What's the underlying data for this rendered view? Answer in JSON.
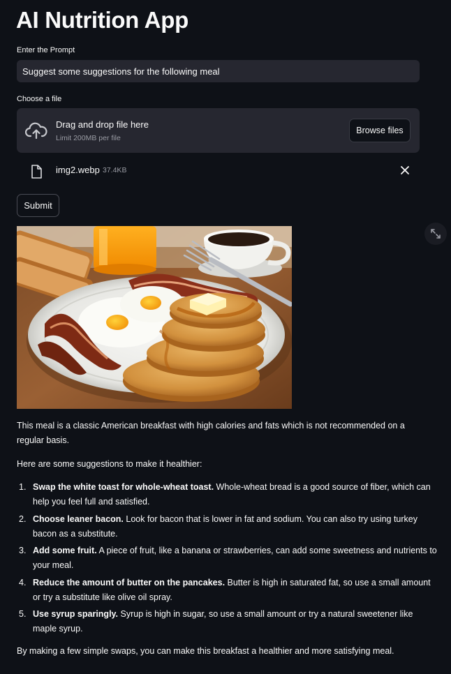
{
  "app": {
    "title": "AI Nutrition App"
  },
  "prompt": {
    "label": "Enter the Prompt",
    "value": "Suggest some suggestions for the following meal"
  },
  "uploader": {
    "label": "Choose a file",
    "drop_text": "Drag and drop file here",
    "limit_text": "Limit 200MB per file",
    "browse_label": "Browse files",
    "file": {
      "name": "img2.webp",
      "size": "37.4KB"
    }
  },
  "submit_label": "Submit",
  "icons": {
    "upload": "cloud-upload-icon",
    "file": "file-icon",
    "remove": "close-icon",
    "fullscreen": "expand-icon"
  },
  "response": {
    "intro": "This meal is a classic American breakfast with high calories and fats which is not recommended on a regular basis.",
    "lead": "Here are some suggestions to make it healthier:",
    "suggestions": [
      {
        "num": "1.",
        "bold": "Swap the white toast for whole-wheat toast.",
        "text": " Whole-wheat bread is a good source of fiber, which can help you feel full and satisfied."
      },
      {
        "num": "2.",
        "bold": "Choose leaner bacon.",
        "text": " Look for bacon that is lower in fat and sodium. You can also try using turkey bacon as a substitute."
      },
      {
        "num": "3.",
        "bold": "Add some fruit.",
        "text": " A piece of fruit, like a banana or strawberries, can add some sweetness and nutrients to your meal."
      },
      {
        "num": "4.",
        "bold": "Reduce the amount of butter on the pancakes.",
        "text": " Butter is high in saturated fat, so use a small amount or try a substitute like olive oil spray."
      },
      {
        "num": "5.",
        "bold": "Use syrup sparingly.",
        "text": " Syrup is high in sugar, so use a small amount or try a natural sweetener like maple syrup."
      }
    ],
    "conclusion": "By making a few simple swaps, you can make this breakfast a healthier and more satisfying meal."
  },
  "colors": {
    "background": "#0e1117",
    "input_bg": "#262730",
    "text": "#fafafa",
    "muted": "#9a9ca4"
  }
}
